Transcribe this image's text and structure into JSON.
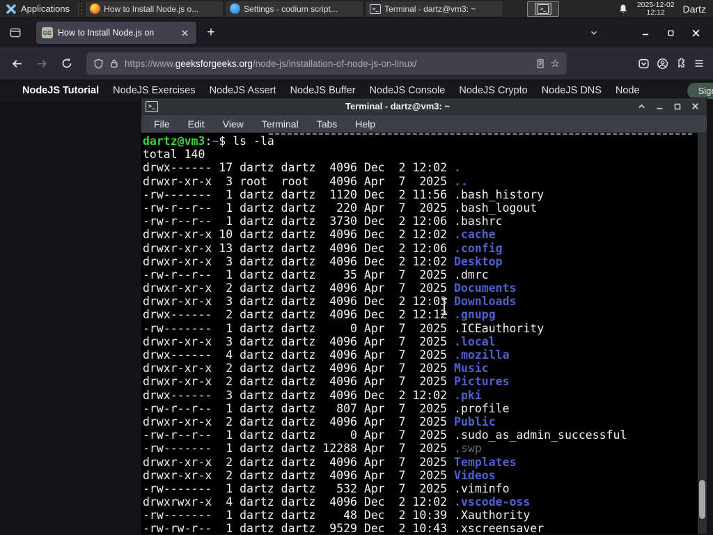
{
  "panel": {
    "applications_label": "Applications",
    "tasks": [
      {
        "title": "How to Install Node.js o...",
        "icon": "firefox"
      },
      {
        "title": "Settings - codium script...",
        "icon": "vscodium"
      },
      {
        "title": "Terminal - dartz@vm3: ~",
        "icon": "terminal"
      }
    ],
    "clock_date": "2025-12-02",
    "clock_time": "12:12",
    "user": "Dartz"
  },
  "browser": {
    "tab_title": "How to Install Node.js on",
    "new_tab_label": "+",
    "url_prefix": "https://www.",
    "url_domain": "geeksforgeeks.org",
    "url_path": "/node-js/installation-of-node-js-on-linux/",
    "bookmark_star": "☆"
  },
  "site_nav": {
    "active": "NodeJS Tutorial",
    "items": [
      "NodeJS Exercises",
      "NodeJS Assert",
      "NodeJS Buffer",
      "NodeJS Console",
      "NodeJS Crypto",
      "NodeJS DNS",
      "Node"
    ],
    "sign_in": "Sign In"
  },
  "terminal_window": {
    "title": "Terminal - dartz@vm3: ~",
    "title_icon_glyph": ">_",
    "menus": [
      "File",
      "Edit",
      "View",
      "Terminal",
      "Tabs",
      "Help"
    ]
  },
  "terminal": {
    "prompt_user": "dartz@vm3",
    "prompt_colon": ":",
    "prompt_path": "~",
    "prompt_rest": "$ ls -la",
    "total_line": "total 140",
    "rows": [
      [
        "drwx------ 17 dartz dartz  4096 Dec  2 12:02 ",
        ".",
        "d"
      ],
      [
        "drwxr-xr-x  3 root  root   4096 Apr  7  2025 ",
        "..",
        "d"
      ],
      [
        "-rw-------  1 dartz dartz  1120 Dec  2 11:56 ",
        ".bash_history",
        "f"
      ],
      [
        "-rw-r--r--  1 dartz dartz   220 Apr  7  2025 ",
        ".bash_logout",
        "f"
      ],
      [
        "-rw-r--r--  1 dartz dartz  3730 Dec  2 12:06 ",
        ".bashrc",
        "f"
      ],
      [
        "drwxr-xr-x 10 dartz dartz  4096 Dec  2 12:02 ",
        ".cache",
        "d"
      ],
      [
        "drwxr-xr-x 13 dartz dartz  4096 Dec  2 12:06 ",
        ".config",
        "d"
      ],
      [
        "drwxr-xr-x  3 dartz dartz  4096 Dec  2 12:02 ",
        "Desktop",
        "d"
      ],
      [
        "-rw-r--r--  1 dartz dartz    35 Apr  7  2025 ",
        ".dmrc",
        "f"
      ],
      [
        "drwxr-xr-x  2 dartz dartz  4096 Apr  7  2025 ",
        "Documents",
        "d"
      ],
      [
        "drwxr-xr-x  3 dartz dartz  4096 Dec  2 12:03 ",
        "Downloads",
        "d"
      ],
      [
        "drwx------  2 dartz dartz  4096 Dec  2 12:12 ",
        ".gnupg",
        "d"
      ],
      [
        "-rw-------  1 dartz dartz     0 Apr  7  2025 ",
        ".ICEauthority",
        "f"
      ],
      [
        "drwxr-xr-x  3 dartz dartz  4096 Apr  7  2025 ",
        ".local",
        "d"
      ],
      [
        "drwx------  4 dartz dartz  4096 Apr  7  2025 ",
        ".mozilla",
        "d"
      ],
      [
        "drwxr-xr-x  2 dartz dartz  4096 Apr  7  2025 ",
        "Music",
        "d"
      ],
      [
        "drwxr-xr-x  2 dartz dartz  4096 Apr  7  2025 ",
        "Pictures",
        "d"
      ],
      [
        "drwx------  3 dartz dartz  4096 Dec  2 12:02 ",
        ".pki",
        "d"
      ],
      [
        "-rw-r--r--  1 dartz dartz   807 Apr  7  2025 ",
        ".profile",
        "f"
      ],
      [
        "drwxr-xr-x  2 dartz dartz  4096 Apr  7  2025 ",
        "Public",
        "d"
      ],
      [
        "-rw-r--r--  1 dartz dartz     0 Apr  7  2025 ",
        ".sudo_as_admin_successful",
        "f"
      ],
      [
        "-rw-------  1 dartz dartz 12288 Apr  7  2025 ",
        ".swp",
        "x"
      ],
      [
        "drwxr-xr-x  2 dartz dartz  4096 Apr  7  2025 ",
        "Templates",
        "d"
      ],
      [
        "drwxr-xr-x  2 dartz dartz  4096 Apr  7  2025 ",
        "Videos",
        "d"
      ],
      [
        "-rw-------  1 dartz dartz   532 Apr  7  2025 ",
        ".viminfo",
        "f"
      ],
      [
        "drwxrwxr-x  4 dartz dartz  4096 Dec  2 12:02 ",
        ".vscode-oss",
        "d"
      ],
      [
        "-rw-------  1 dartz dartz    48 Dec  2 10:39 ",
        ".Xauthority",
        "f"
      ],
      [
        "-rw-rw-r--  1 dartz dartz  9529 Dec  2 10:43 ",
        ".xscreensaver",
        "f"
      ]
    ]
  },
  "colors": {
    "panel_bg": "#262626",
    "tabbar_bg": "#1c1b22",
    "toolbar_bg": "#2b2a33",
    "urlbar_bg": "#42414d",
    "site_nav_bg": "#16181c",
    "gfg_green": "#2aa05a",
    "terminal_bg": "#000000",
    "terminal_text": "#f2f2f2",
    "terminal_dir_blue": "#5060d0",
    "terminal_prompt_green": "#3ecf3e",
    "terminal_dim": "#6b6b6b",
    "titlebar_bg": "#2f3338"
  }
}
